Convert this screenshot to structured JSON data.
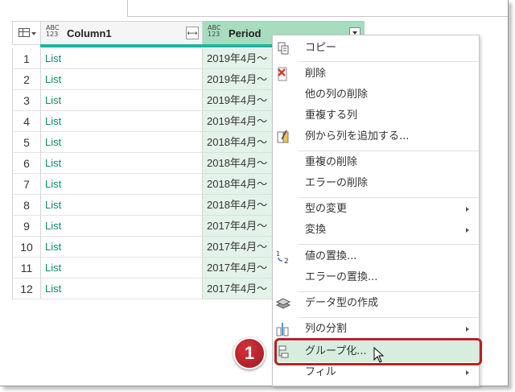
{
  "grid": {
    "col1": {
      "type_top": "ABC",
      "type_bottom": "123",
      "header": "Column1"
    },
    "col2": {
      "type_top": "ABC",
      "type_bottom": "123",
      "header": "Period"
    },
    "rows": [
      {
        "num": "1",
        "c1": "List",
        "c2": "2019年4月～"
      },
      {
        "num": "2",
        "c1": "List",
        "c2": "2019年4月～"
      },
      {
        "num": "3",
        "c1": "List",
        "c2": "2019年4月～"
      },
      {
        "num": "4",
        "c1": "List",
        "c2": "2019年4月～"
      },
      {
        "num": "5",
        "c1": "List",
        "c2": "2018年4月～"
      },
      {
        "num": "6",
        "c1": "List",
        "c2": "2018年4月～"
      },
      {
        "num": "7",
        "c1": "List",
        "c2": "2018年4月～"
      },
      {
        "num": "8",
        "c1": "List",
        "c2": "2018年4月～"
      },
      {
        "num": "9",
        "c1": "List",
        "c2": "2017年4月～"
      },
      {
        "num": "10",
        "c1": "List",
        "c2": "2017年4月～"
      },
      {
        "num": "11",
        "c1": "List",
        "c2": "2017年4月～"
      },
      {
        "num": "12",
        "c1": "List",
        "c2": "2017年4月～"
      }
    ]
  },
  "menu": {
    "copy": "コピー",
    "remove": "削除",
    "remove_other": "他の列の削除",
    "duplicate": "重複する列",
    "add_from_examples": "例から列を追加する...",
    "remove_duplicates": "重複の削除",
    "remove_errors": "エラーの削除",
    "change_type": "型の変更",
    "transform": "変換",
    "replace_values": "値の置換...",
    "replace_errors": "エラーの置換...",
    "create_data_type": "データ型の作成",
    "split_column": "列の分割",
    "group_by": "グループ化...",
    "fill": "フィル",
    "replace_values_icon_text": "1→2"
  },
  "callout": {
    "number": "1"
  },
  "colors": {
    "accent": "#1ab5a4",
    "selected_col": "#a7dcbe",
    "callout": "#b52227",
    "link_text": "#0f8a66"
  }
}
